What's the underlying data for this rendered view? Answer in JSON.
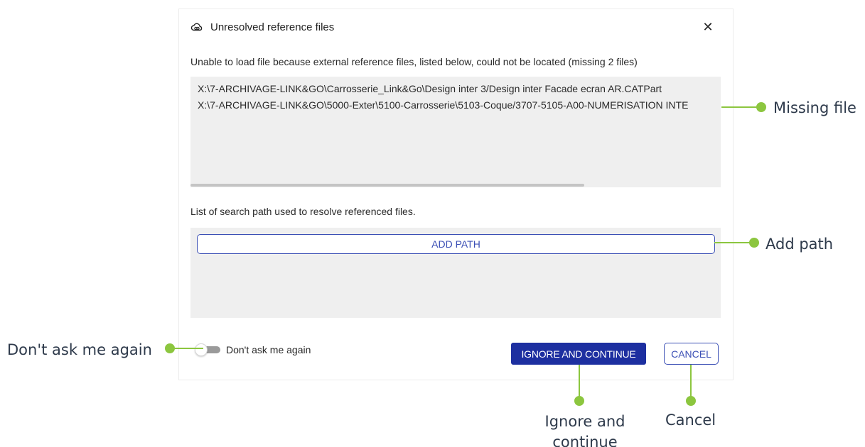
{
  "dialog": {
    "title": "Unresolved reference files",
    "title_icon": "cloud-link-icon",
    "close_label": "✕",
    "message": "Unable to load file because external reference files, listed below, could not be located (missing 2 files)",
    "missing_files": [
      "X:\\7-ARCHIVAGE-LINK&GO\\Carrosserie_Link&Go\\Design inter 3/Design inter Facade ecran AR.CATPart",
      "X:\\7-ARCHIVAGE-LINK&GO\\5000-Exter\\5100-Carrosserie\\5103-Coque/3707-5105-A00-NUMERISATION INTE"
    ],
    "search_path_label": "List of search path used to resolve referenced files.",
    "add_path_label": "ADD PATH",
    "dont_ask_label": "Don't ask me again",
    "ignore_label": "IGNORE AND CONTINUE",
    "cancel_label": "CANCEL"
  },
  "callouts": {
    "missing_file": "Missing file",
    "add_path": "Add path",
    "dont_ask": "Don't ask me again",
    "ignore_and_continue": "Ignore and continue",
    "cancel": "Cancel"
  },
  "colors": {
    "primary": "#1d2fa0",
    "outline": "#3b4fb5",
    "callout": "#8cc63f",
    "panel_bg": "#efefef"
  }
}
